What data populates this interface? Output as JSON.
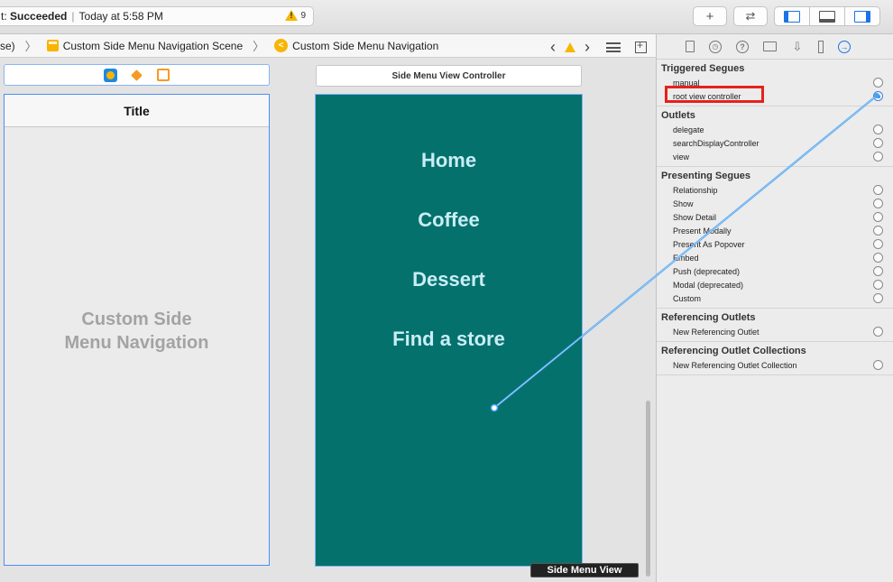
{
  "toolbar": {
    "status_prefix": "t:",
    "status_result": "Succeeded",
    "status_time": "Today at 5:58 PM",
    "warning_count": "9",
    "add_label": "+",
    "swap_label": "⇄"
  },
  "jumpbar": {
    "crumb_0": "se)",
    "crumb_1": "Custom Side Menu Navigation Scene",
    "crumb_2": "Custom Side Menu Navigation",
    "back": "‹",
    "fwd": "›"
  },
  "canvas": {
    "nav_title": "Title",
    "nav_caption_1": "Custom Side",
    "nav_caption_2": "Menu Navigation",
    "side_controller_title": "Side Menu View Controller",
    "menu": [
      "Home",
      "Coffee",
      "Dessert",
      "Find a store"
    ],
    "side_view_badge": "Side Menu View",
    "colors": {
      "menu_bg": "#05716d",
      "menu_text": "#c9eef5",
      "connector": "#4aa1f0"
    }
  },
  "inspector": {
    "triggered_segues": {
      "title": "Triggered Segues",
      "items": [
        "manual",
        "root view controller"
      ]
    },
    "outlets": {
      "title": "Outlets",
      "items": [
        "delegate",
        "searchDisplayController",
        "view"
      ]
    },
    "presenting_segues": {
      "title": "Presenting Segues",
      "items": [
        "Relationship",
        "Show",
        "Show Detail",
        "Present Modally",
        "Present As Popover",
        "Embed",
        "Push (deprecated)",
        "Modal (deprecated)",
        "Custom"
      ]
    },
    "referencing_outlets": {
      "title": "Referencing Outlets",
      "items": [
        "New Referencing Outlet"
      ]
    },
    "referencing_collections": {
      "title": "Referencing Outlet Collections",
      "items": [
        "New Referencing Outlet Collection"
      ]
    },
    "highlight_color": "#e6211b"
  }
}
